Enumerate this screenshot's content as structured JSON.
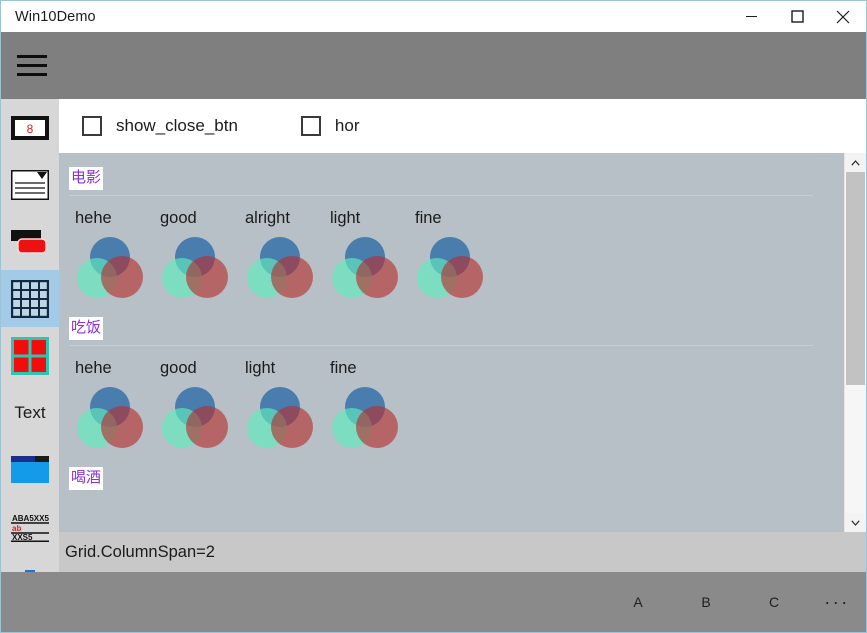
{
  "window": {
    "title": "Win10Demo",
    "controls": [
      {
        "name": "minimize",
        "glyph": "minimize-icon"
      },
      {
        "name": "maximize",
        "glyph": "maximize-icon"
      },
      {
        "name": "close",
        "glyph": "close-icon"
      }
    ]
  },
  "nav": {
    "hamburger": "hamburger-icon",
    "items": [
      {
        "icon": "id-card-icon",
        "label": "",
        "selected": false
      },
      {
        "icon": "document-list-icon",
        "label": "",
        "selected": false
      },
      {
        "icon": "red-button-icon",
        "label": "",
        "selected": false
      },
      {
        "icon": "grid-table-icon",
        "label": "",
        "selected": true
      },
      {
        "icon": "four-squares-icon",
        "label": "",
        "selected": false
      },
      {
        "icon": "text-icon",
        "label": "Text",
        "selected": false
      },
      {
        "icon": "folder-icon",
        "label": "",
        "selected": false
      },
      {
        "icon": "text-lines-icon",
        "label": "",
        "selected": false
      },
      {
        "icon": "download-icon",
        "label": "",
        "selected": false
      }
    ]
  },
  "options": {
    "checkboxes": [
      {
        "label": "show_close_btn",
        "checked": false
      },
      {
        "label": "hor",
        "checked": false
      }
    ]
  },
  "groups": [
    {
      "header": "电影",
      "items": [
        "hehe",
        "good",
        "alright",
        "light",
        "fine"
      ]
    },
    {
      "header": "吃饭",
      "items": [
        "hehe",
        "good",
        "light",
        "fine"
      ]
    },
    {
      "header": "喝酒",
      "items": []
    }
  ],
  "status": {
    "text": "Grid.ColumnSpan=2"
  },
  "commandbar": {
    "buttons": [
      "A",
      "B",
      "C"
    ],
    "more": "···"
  },
  "scrollbar": {
    "up": "chevron-up-icon",
    "down": "chevron-down-icon"
  },
  "colors": {
    "accent_purple": "#8b2fd4",
    "selected_nav": "#a3cbe8",
    "content_bg": "#b6c0c6",
    "chrome_gray": "#7f7f7f",
    "venn_blue": "#1f62a3",
    "venn_green": "#60ebbe",
    "venn_red": "#b62d2d"
  }
}
